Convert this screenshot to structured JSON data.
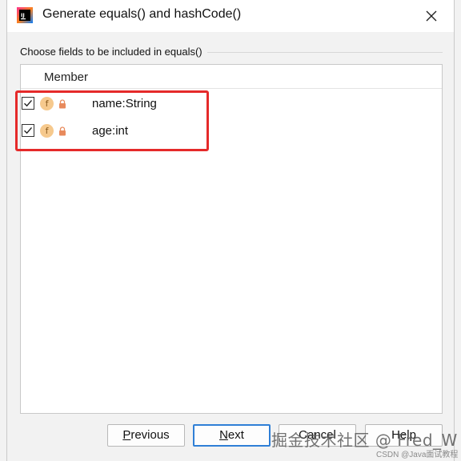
{
  "window": {
    "title": "Generate equals() and hashCode()",
    "icon": "intellij-app-icon"
  },
  "group": {
    "label": "Choose fields to be included in equals()"
  },
  "table": {
    "header": "Member",
    "rows": [
      {
        "checked": true,
        "kind_icon": "field-icon",
        "kind_letter": "f",
        "access_icon": "lock-icon",
        "name": "name:String"
      },
      {
        "checked": true,
        "kind_icon": "field-icon",
        "kind_letter": "f",
        "access_icon": "lock-icon",
        "name": "age:int"
      }
    ]
  },
  "buttons": {
    "previous": {
      "mnemonic": "P",
      "rest": "revious"
    },
    "next": {
      "mnemonic": "N",
      "rest": "ext"
    },
    "cancel": "Cancel",
    "help": "Help"
  },
  "watermark": {
    "main": "掘金技术社区 @ Fred_W",
    "sub": "CSDN @Java面试教程"
  },
  "colors": {
    "highlight": "#e52a2a",
    "focus_border": "#2f7fd6",
    "field_icon_bg": "#f6c98d",
    "lock_icon": "#e88a5c"
  }
}
